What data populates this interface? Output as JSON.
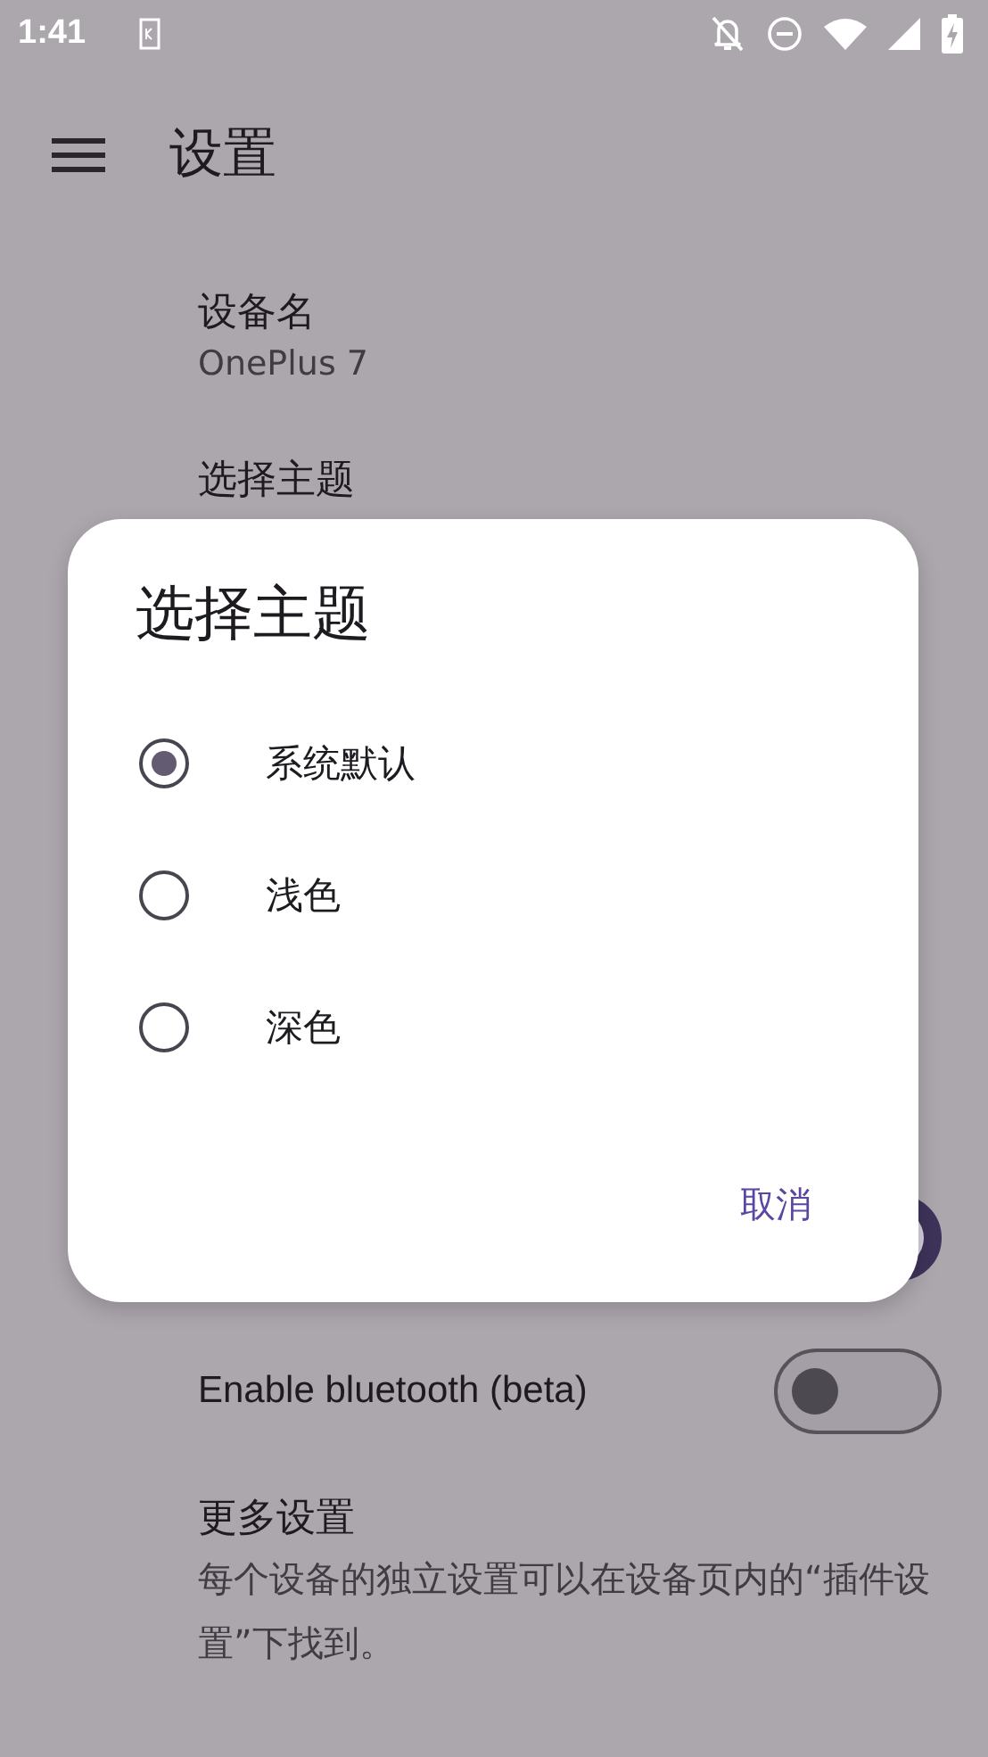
{
  "status_bar": {
    "time": "1:41"
  },
  "app_bar": {
    "title": "设置"
  },
  "settings": [
    {
      "kind": "text",
      "title": "设备名",
      "summary": "OnePlus 7"
    },
    {
      "kind": "text",
      "title": "选择主题"
    },
    {
      "kind": "switch",
      "on": true
    },
    {
      "kind": "switch",
      "title": "Enable bluetooth (beta)",
      "on": false
    },
    {
      "kind": "text",
      "title": "更多设置",
      "summary": "每个设备的独立设置可以在设备页内的“插件设置”下找到。"
    }
  ],
  "dialog": {
    "title": "选择主题",
    "options": [
      {
        "label": "系统默认",
        "selected": true
      },
      {
        "label": "浅色",
        "selected": false
      },
      {
        "label": "深色",
        "selected": false
      }
    ],
    "buttons": [
      "取消"
    ]
  }
}
